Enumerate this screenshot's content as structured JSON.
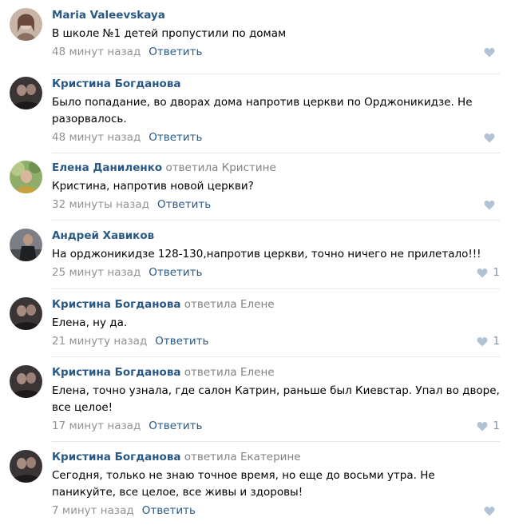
{
  "colors": {
    "author": "#2a5885",
    "muted": "#939393",
    "heart": "#b3c3d6",
    "divider": "#e7e8ec"
  },
  "comments": [
    {
      "author": "Maria Valeevskaya",
      "reply_to": "",
      "text": "В школе №1 детей пропустили по домам",
      "time": "48 минут назад",
      "reply_label": "Ответить",
      "likes": ""
    },
    {
      "author": "Кристина Богданова",
      "reply_to": "",
      "text": "Было попадание, во дворах дома напротив церкви по Орджоникидзе. Не разорвалось.",
      "time": "48 минут назад",
      "reply_label": "Ответить",
      "likes": ""
    },
    {
      "author": "Елена Даниленко",
      "reply_to": "ответила Кристине",
      "text": "Кристина, напротив новой церкви?",
      "time": "32 минуты назад",
      "reply_label": "Ответить",
      "likes": ""
    },
    {
      "author": "Андрей Хавиков",
      "reply_to": "",
      "text": "На орджоникидзе 128-130,напротив церкви, точно ничего не прилетало!!!",
      "time": "25 минут назад",
      "reply_label": "Ответить",
      "likes": "1"
    },
    {
      "author": "Кристина Богданова",
      "reply_to": "ответила Елене",
      "text": "Елена, ну да.",
      "time": "21 минуту назад",
      "reply_label": "Ответить",
      "likes": "1"
    },
    {
      "author": "Кристина Богданова",
      "reply_to": "ответила Елене",
      "text": "Елена, точно узнала, где салон Катрин, раньше был Киевстар. Упал во дворе, все целое!",
      "time": "17 минут назад",
      "reply_label": "Ответить",
      "likes": "1"
    },
    {
      "author": "Кристина Богданова",
      "reply_to": "ответила Екатерине",
      "text": "Сегодня, только не знаю точное время, но еще до восьми утра. Не паникуйте, все целое, все живы и здоровы!",
      "time": "7 минут назад",
      "reply_label": "Ответить",
      "likes": ""
    }
  ]
}
